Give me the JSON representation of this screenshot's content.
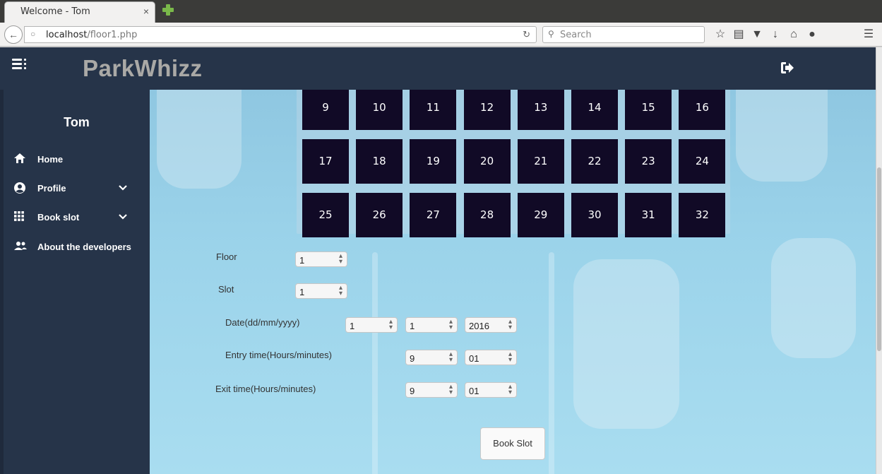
{
  "browser": {
    "tab_title": "Welcome - Tom",
    "tab_close": "×",
    "url_host": "localhost",
    "url_path": "/floor1.php",
    "search_placeholder": "Search"
  },
  "app": {
    "brand": "ParkWhizz",
    "username": "Tom"
  },
  "sidebar": {
    "items": [
      {
        "label": "Home",
        "icon": "home-icon"
      },
      {
        "label": "Profile",
        "icon": "account-icon",
        "has_dropdown": true
      },
      {
        "label": "Book slot",
        "icon": "grid-icon",
        "has_dropdown": true
      },
      {
        "label": "About the developers",
        "icon": "people-icon"
      }
    ]
  },
  "slots": [
    "9",
    "10",
    "11",
    "12",
    "13",
    "14",
    "15",
    "16",
    "17",
    "18",
    "19",
    "20",
    "21",
    "22",
    "23",
    "24",
    "25",
    "26",
    "27",
    "28",
    "29",
    "30",
    "31",
    "32"
  ],
  "form": {
    "floor_label": "Floor",
    "floor_value": "1",
    "slot_label": "Slot",
    "slot_value": "1",
    "date_label": "Date(dd/mm/yyyy)",
    "date_day": "1",
    "date_month": "1",
    "date_year": "2016",
    "entry_label": "Entry time(Hours/minutes)",
    "entry_hours": "9",
    "entry_minutes": "01",
    "exit_label": "Exit time(Hours/minutes)",
    "exit_hours": "9",
    "exit_minutes": "01",
    "book_button": "Book Slot"
  },
  "colors": {
    "header_bg": "#263449",
    "slot_bg": "#110a26",
    "main_bg": "#9bd3ea"
  }
}
